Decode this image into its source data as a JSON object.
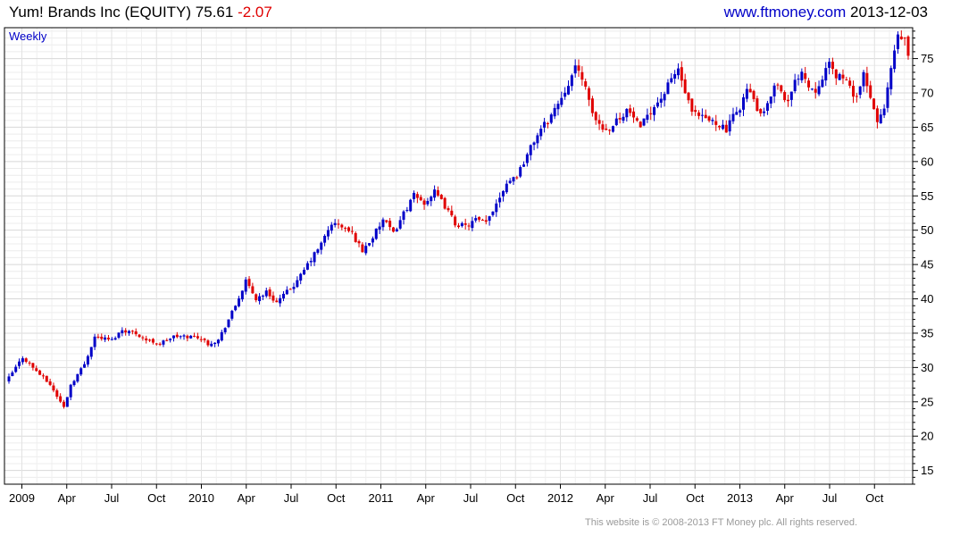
{
  "header": {
    "symbol": "Yum! Brands Inc (EQUITY)",
    "last": "75.61",
    "change": "-2.07",
    "site": "www.ftmoney.com",
    "date": "2013-12-03"
  },
  "footer": {
    "text": "This website is © 2008-2013 FT Money plc. All rights reserved."
  },
  "colors": {
    "up": "#0000c8",
    "down": "#e00000",
    "grid": "#d8d8d8",
    "frame": "#000000"
  },
  "chart_data": {
    "type": "candlestick",
    "period": "Weekly",
    "ylim": [
      13,
      79.5
    ],
    "yticks": [
      15,
      20,
      25,
      30,
      35,
      40,
      45,
      50,
      55,
      60,
      65,
      70,
      75
    ],
    "xlabels": [
      "2009",
      "Apr",
      "Jul",
      "Oct",
      "2010",
      "Apr",
      "Jul",
      "Oct",
      "2011",
      "Apr",
      "Jul",
      "Oct",
      "2012",
      "Apr",
      "Jul",
      "Oct",
      "2013",
      "Apr",
      "Jul",
      "Oct"
    ],
    "price_path": [
      [
        0,
        28.5
      ],
      [
        4,
        31.5
      ],
      [
        8,
        29.5
      ],
      [
        12,
        27.5
      ],
      [
        15,
        25
      ],
      [
        16,
        24.2
      ],
      [
        18,
        27.5
      ],
      [
        22,
        30.5
      ],
      [
        25,
        34.5
      ],
      [
        30,
        34
      ],
      [
        33,
        35.5
      ],
      [
        37,
        35
      ],
      [
        40,
        34
      ],
      [
        44,
        33.5
      ],
      [
        48,
        34.5
      ],
      [
        51,
        34.5
      ],
      [
        55,
        34.5
      ],
      [
        58,
        33.5
      ],
      [
        61,
        34
      ],
      [
        66,
        39
      ],
      [
        69,
        42.5
      ],
      [
        72,
        40
      ],
      [
        75,
        41
      ],
      [
        78,
        39.5
      ],
      [
        81,
        41
      ],
      [
        84,
        42.5
      ],
      [
        87,
        45
      ],
      [
        91,
        48
      ],
      [
        94,
        51
      ],
      [
        97,
        50.5
      ],
      [
        100,
        49.5
      ],
      [
        103,
        47
      ],
      [
        106,
        49
      ],
      [
        109,
        51.5
      ],
      [
        112,
        49.5
      ],
      [
        115,
        52.5
      ],
      [
        118,
        55
      ],
      [
        121,
        54
      ],
      [
        124,
        55.5
      ],
      [
        127,
        53.5
      ],
      [
        130,
        51
      ],
      [
        133,
        50.5
      ],
      [
        136,
        51.5
      ],
      [
        139,
        51
      ],
      [
        142,
        54
      ],
      [
        145,
        57
      ],
      [
        148,
        58
      ],
      [
        151,
        61
      ],
      [
        154,
        64
      ],
      [
        157,
        66
      ],
      [
        160,
        68.5
      ],
      [
        163,
        71.5
      ],
      [
        165,
        73.5
      ],
      [
        167,
        72.5
      ],
      [
        169,
        68.5
      ],
      [
        171,
        66
      ],
      [
        174,
        64.5
      ],
      [
        177,
        66
      ],
      [
        180,
        67.5
      ],
      [
        182,
        66.5
      ],
      [
        184,
        64.5
      ],
      [
        186,
        67
      ],
      [
        188,
        68
      ],
      [
        191,
        70
      ],
      [
        193,
        72
      ],
      [
        195,
        73.5
      ],
      [
        197,
        70
      ],
      [
        199,
        67
      ],
      [
        201,
        66.5
      ],
      [
        204,
        66
      ],
      [
        207,
        65.5
      ],
      [
        209,
        64.5
      ],
      [
        211,
        66.5
      ],
      [
        213,
        68
      ],
      [
        215,
        70.5
      ],
      [
        217,
        69
      ],
      [
        219,
        66.5
      ],
      [
        221,
        68
      ],
      [
        223,
        71.5
      ],
      [
        225,
        70.5
      ],
      [
        227,
        68.5
      ],
      [
        229,
        71.5
      ],
      [
        231,
        73.5
      ],
      [
        233,
        71
      ],
      [
        235,
        70.5
      ],
      [
        237,
        72.5
      ],
      [
        239,
        74
      ],
      [
        241,
        72.5
      ],
      [
        243,
        72.5
      ],
      [
        245,
        70.5
      ],
      [
        247,
        69.5
      ],
      [
        249,
        72.5
      ],
      [
        251,
        69
      ],
      [
        253,
        66
      ],
      [
        255,
        67.5
      ],
      [
        257,
        73.5
      ],
      [
        259,
        78
      ],
      [
        261,
        77.7
      ],
      [
        262,
        75.6
      ]
    ]
  },
  "legend": {
    "period_label": "Weekly"
  }
}
